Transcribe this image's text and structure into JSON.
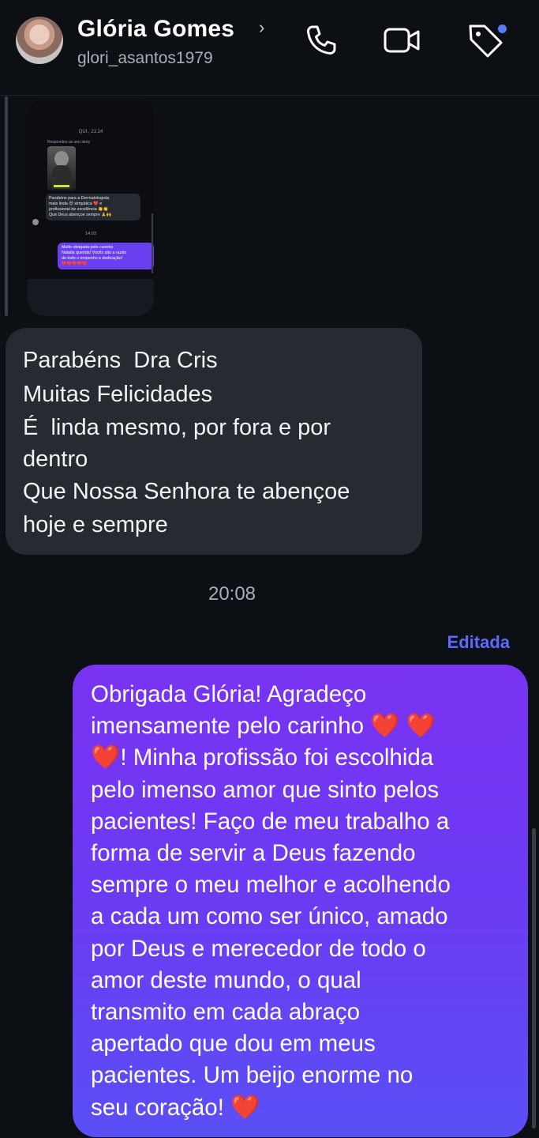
{
  "header": {
    "name": "Glória Gomes",
    "username": "glori_asantos1979",
    "icons": [
      "chevron-right-icon",
      "phone-icon",
      "video-camera-icon",
      "tag-icon"
    ]
  },
  "shared_screenshot": {
    "time": "QUI., 21:24",
    "replied": "Respondeu ao seu story",
    "message_lines": [
      "Parabéns para a Dermatologista",
      "mais linda 😍 simpática ❤️ e",
      "profissional de excelência 👏👏",
      "Que Deus abençoe sempre 🙏🙌"
    ],
    "time2": "14:03",
    "reply_lines": [
      "Muito obrigada pelo carinho",
      "Natalia querida! Vocês são a razão",
      "de todo o empenho e dedicação!",
      "❤️❤️❤️❤️❤️"
    ]
  },
  "received_message": {
    "lines": [
      "Parabéns  Dra Cris",
      "Muitas Felicidades",
      "É  linda mesmo, por fora e por",
      "dentro",
      "Que Nossa Senhora te abençoe",
      "hoje e sempre"
    ]
  },
  "timestamp": "20:08",
  "edited_label": "Editada",
  "sent_message": {
    "lines": [
      "Obrigada Glória! Agradeço",
      "imensamente pelo carinho",
      "! Minha profissão foi escolhida",
      "pelo imenso amor que sinto pelos",
      "pacientes! Faço de meu trabalho a",
      "forma de servir a Deus fazendo",
      "sempre o meu melhor e acolhendo",
      "a cada um como ser único, amado",
      "por Deus e merecedor de todo o",
      "amor deste mundo, o qual",
      "transmito em cada abraço",
      "apertado que dou em meus",
      "pacientes. Um beijo enorme no",
      "seu coração!"
    ],
    "heart": "❤️"
  },
  "colors": {
    "background": "#0c0f14",
    "received_bubble": "#262a31",
    "sent_gradient_top": "#7a33f3",
    "sent_gradient_bottom": "#5a4ff5",
    "edited": "#5b6bff",
    "heart": "#e8162a"
  }
}
